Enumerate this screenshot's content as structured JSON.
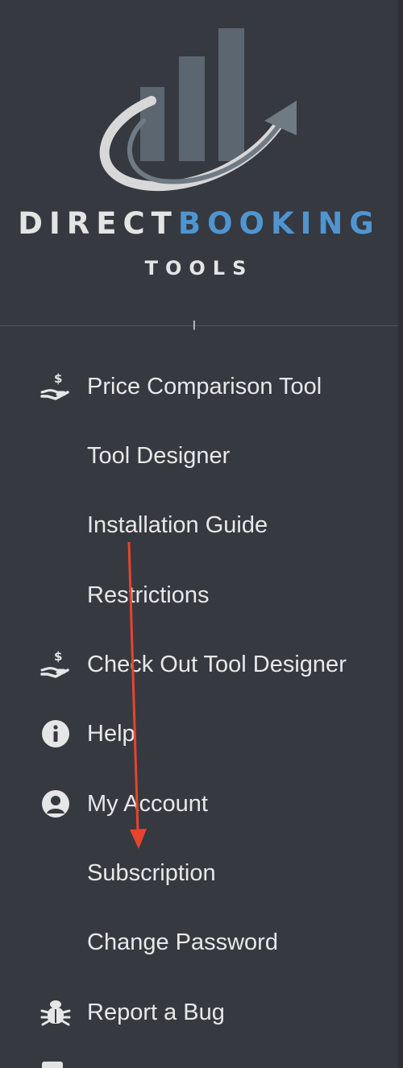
{
  "brand": {
    "name_part1": "DIRECT",
    "name_part2": "BOOKING",
    "tagline": "TOOLS"
  },
  "menu": [
    {
      "label": "Price Comparison Tool",
      "icon": "hand-dollar-icon"
    },
    {
      "label": "Tool Designer",
      "icon": ""
    },
    {
      "label": "Installation Guide",
      "icon": ""
    },
    {
      "label": "Restrictions",
      "icon": ""
    },
    {
      "label": "Check Out Tool Designer",
      "icon": "hand-dollar-icon"
    },
    {
      "label": "Help",
      "icon": "info-circle-icon"
    },
    {
      "label": "My Account",
      "icon": "user-circle-icon"
    },
    {
      "label": "Subscription",
      "icon": ""
    },
    {
      "label": "Change Password",
      "icon": ""
    },
    {
      "label": "Report a Bug",
      "icon": "bug-icon"
    }
  ],
  "colors": {
    "sidebar_bg": "#363940",
    "brand_accent": "#4f95d0",
    "text": "#e8e8e8",
    "annotation_arrow": "#e8432c"
  }
}
